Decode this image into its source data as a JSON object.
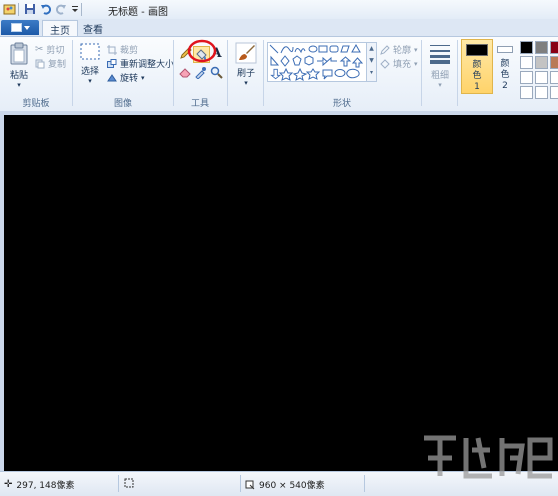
{
  "window": {
    "title": "无标题 - 画图"
  },
  "tabs": [
    {
      "label": "主页"
    },
    {
      "label": "查看"
    }
  ],
  "clipboard": {
    "paste": "粘贴",
    "cut": "剪切",
    "copy": "复制",
    "group": "剪贴板"
  },
  "image": {
    "select": "选择",
    "crop": "裁剪",
    "resize": "重新调整大小",
    "rotate": "旋转",
    "group": "图像"
  },
  "tools": {
    "group": "工具"
  },
  "brushes": {
    "label": "刷子"
  },
  "shapes": {
    "outline": "轮廓",
    "fill": "填充",
    "group": "形状"
  },
  "size": {
    "label": "粗细"
  },
  "colors": {
    "color1": "颜色 1",
    "color2": "颜色 2",
    "color1_value": "#000000",
    "color2_value": "#ffffff"
  },
  "status": {
    "cursor_pos": "297, 148像素",
    "canvas_size": "960 × 540像素"
  },
  "accent": {
    "ribbon_bg": "#e6eef8",
    "canvas": "#000000",
    "highlight_circle": "#e0141e"
  }
}
